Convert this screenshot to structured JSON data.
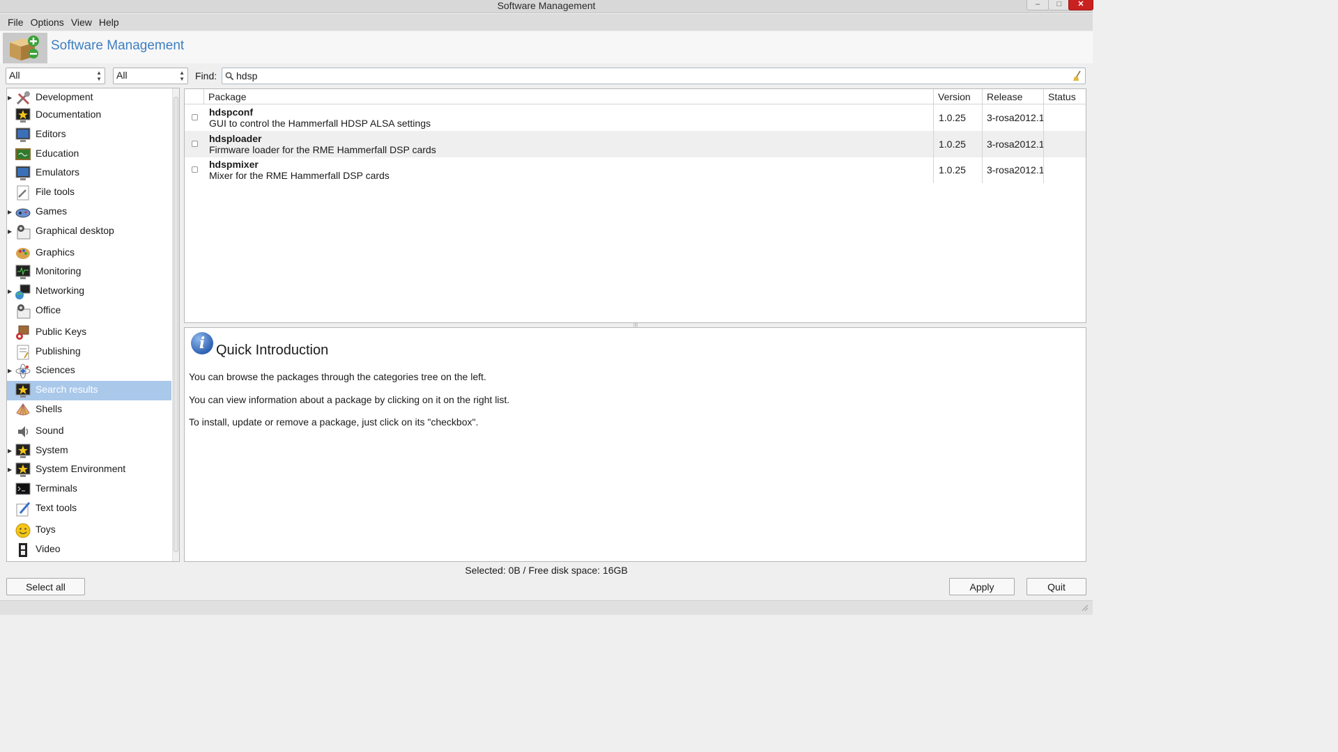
{
  "window": {
    "title": "Software Management"
  },
  "menu": [
    "File",
    "Options",
    "View",
    "Help"
  ],
  "header": {
    "title": "Software Management"
  },
  "filters": {
    "group_filter": "All",
    "status_filter": "All",
    "find_label": "Find:",
    "search_value": "hdsp"
  },
  "categories": [
    {
      "label": "Development",
      "icon": "tools-icon",
      "expandable": true
    },
    {
      "label": "Documentation",
      "icon": "star-monitor-icon",
      "expandable": false
    },
    {
      "label": "Editors",
      "icon": "monitor-icon",
      "expandable": false
    },
    {
      "label": "Education",
      "icon": "chalkboard-icon",
      "expandable": false
    },
    {
      "label": "Emulators",
      "icon": "monitor-icon",
      "expandable": false
    },
    {
      "label": "File tools",
      "icon": "wrench-document-icon",
      "expandable": false
    },
    {
      "label": "Games",
      "icon": "gamepad-icon",
      "expandable": true
    },
    {
      "label": "Graphical desktop",
      "icon": "desktop-icon",
      "expandable": true
    },
    {
      "label": "Graphics",
      "icon": "palette-icon",
      "expandable": false
    },
    {
      "label": "Monitoring",
      "icon": "monitoring-icon",
      "expandable": false
    },
    {
      "label": "Networking",
      "icon": "network-icon",
      "expandable": true
    },
    {
      "label": "Office",
      "icon": "office-icon",
      "expandable": false
    },
    {
      "label": "Public Keys",
      "icon": "keys-icon",
      "expandable": false
    },
    {
      "label": "Publishing",
      "icon": "publishing-icon",
      "expandable": false
    },
    {
      "label": "Sciences",
      "icon": "sciences-icon",
      "expandable": true
    },
    {
      "label": "Search results",
      "icon": "star-monitor-icon",
      "expandable": false,
      "selected": true
    },
    {
      "label": "Shells",
      "icon": "shell-icon",
      "expandable": false
    },
    {
      "label": "Sound",
      "icon": "speaker-icon",
      "expandable": false
    },
    {
      "label": "System",
      "icon": "star-monitor-icon",
      "expandable": true
    },
    {
      "label": "System Environment",
      "icon": "star-monitor-icon",
      "expandable": true
    },
    {
      "label": "Terminals",
      "icon": "terminal-icon",
      "expandable": false
    },
    {
      "label": "Text tools",
      "icon": "pen-icon",
      "expandable": false
    },
    {
      "label": "Toys",
      "icon": "smiley-icon",
      "expandable": false
    },
    {
      "label": "Video",
      "icon": "film-icon",
      "expandable": false
    }
  ],
  "packages": {
    "columns": [
      "Package",
      "Version",
      "Release",
      "Status"
    ],
    "rows": [
      {
        "name": "hdspconf",
        "description": "GUI to control the Hammerfall HDSP ALSA settings",
        "version": "1.0.25",
        "release": "3-rosa2012.1",
        "status": ""
      },
      {
        "name": "hdsploader",
        "description": "Firmware loader for the RME Hammerfall DSP cards",
        "version": "1.0.25",
        "release": "3-rosa2012.1",
        "status": ""
      },
      {
        "name": "hdspmixer",
        "description": "Mixer for the RME Hammerfall DSP cards",
        "version": "1.0.25",
        "release": "3-rosa2012.1",
        "status": ""
      }
    ]
  },
  "info": {
    "title": "Quick Introduction",
    "paragraphs": [
      "You can browse the packages through the categories tree on the left.",
      "You can view information about a package by clicking on it on the right list.",
      "To install, update or remove a package, just click on its \"checkbox\"."
    ]
  },
  "status_text": "Selected: 0B / Free disk space: 16GB",
  "buttons": {
    "select_all": "Select all",
    "apply": "Apply",
    "quit": "Quit"
  },
  "colors": {
    "accent": "#3e7ec2",
    "selection": "#a9c8ea",
    "close": "#c92020"
  }
}
